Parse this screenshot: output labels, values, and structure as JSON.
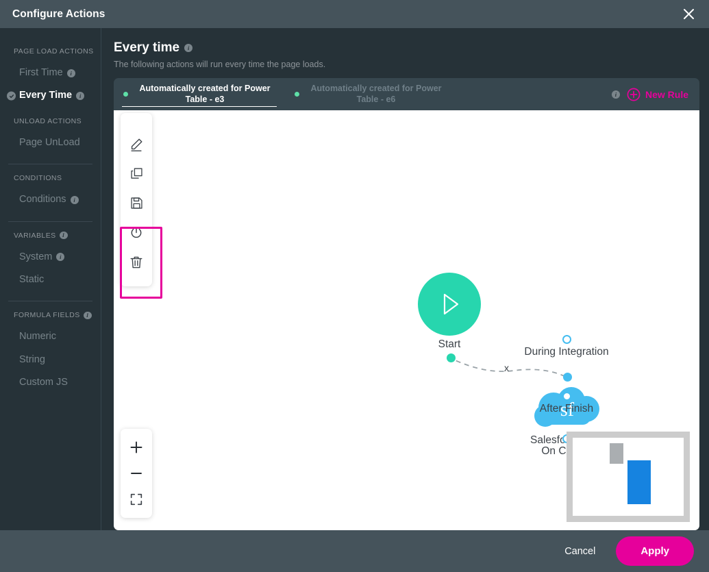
{
  "window": {
    "title": "Configure Actions",
    "close_icon": "close-icon"
  },
  "sidebar": {
    "groups": [
      {
        "label": "PAGE LOAD ACTIONS",
        "has_info": false,
        "items": [
          {
            "label": "First Time",
            "has_info": true,
            "active": false
          },
          {
            "label": "Every Time",
            "has_info": true,
            "active": true
          }
        ]
      },
      {
        "label": "UNLOAD ACTIONS",
        "has_info": false,
        "items": [
          {
            "label": "Page UnLoad",
            "has_info": false,
            "active": false
          }
        ]
      },
      {
        "label": "CONDITIONS",
        "has_info": false,
        "items": [
          {
            "label": "Conditions",
            "has_info": true,
            "active": false
          }
        ]
      },
      {
        "label": "VARIABLES",
        "has_info": true,
        "items": [
          {
            "label": "System",
            "has_info": true,
            "active": false
          },
          {
            "label": "Static",
            "has_info": false,
            "active": false
          }
        ]
      },
      {
        "label": "FORMULA FIELDS",
        "has_info": true,
        "items": [
          {
            "label": "Numeric",
            "has_info": false,
            "active": false
          },
          {
            "label": "String",
            "has_info": false,
            "active": false
          },
          {
            "label": "Custom JS",
            "has_info": false,
            "active": false
          }
        ]
      }
    ]
  },
  "main": {
    "title": "Every time",
    "title_has_info": true,
    "subtitle": "The following actions will run every time the page loads.",
    "tabs": [
      {
        "label": "Automatically created for Power Table - e3",
        "active": true,
        "dot_color": "#5fe0a8"
      },
      {
        "label": "Automatically created for Power Table - e6",
        "active": false,
        "dot_color": "#5fe0a8"
      }
    ],
    "new_rule": {
      "label": "New Rule",
      "icon": "plus-circle-icon",
      "color": "#e6009b",
      "has_info": true
    }
  },
  "canvas": {
    "toolbar": {
      "items": [
        {
          "name": "edit-icon",
          "label": "Edit"
        },
        {
          "name": "copy-icon",
          "label": "Copy"
        },
        {
          "name": "save-icon",
          "label": "Save"
        },
        {
          "name": "power-icon",
          "label": "Enable/Disable"
        },
        {
          "name": "trash-icon",
          "label": "Delete"
        }
      ],
      "highlight_color": "#e6009b"
    },
    "zoom_controls": [
      {
        "name": "zoom-in-icon",
        "label": "Zoom In"
      },
      {
        "name": "zoom-out-icon",
        "label": "Zoom Out"
      },
      {
        "name": "fit-screen-icon",
        "label": "Fit to Screen"
      }
    ],
    "nodes": {
      "start": {
        "label": "Start",
        "icon": "play-icon",
        "color": "#27d6ae"
      },
      "salesforce": {
        "label": "Salesforce Action",
        "icon": "salesforce-cloud-icon",
        "badge_text": "sf",
        "color": "#45bdf0"
      }
    },
    "outputs": [
      {
        "label": "During Integration"
      },
      {
        "label": "After Finish"
      },
      {
        "label": "On Cancel"
      }
    ],
    "connector": {
      "marker": "x",
      "style": "dashed",
      "color": "#9aa3a8"
    },
    "minimap": {
      "viewport_color": "#1683e0",
      "node_color": "#aaaeb1",
      "frame_color": "#cccccc"
    }
  },
  "footer": {
    "cancel_label": "Cancel",
    "apply_label": "Apply",
    "apply_color": "#e6009b"
  }
}
